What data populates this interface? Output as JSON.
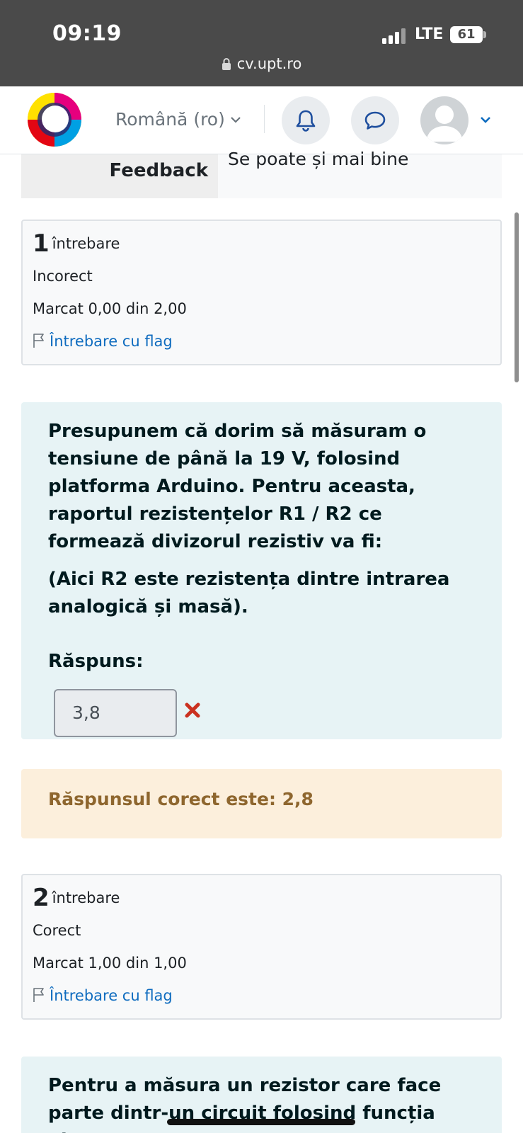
{
  "status_bar": {
    "time": "09:19",
    "network": "LTE",
    "battery": "61"
  },
  "browser": {
    "url": "cv.upt.ro"
  },
  "nav": {
    "language": "Română (ro)"
  },
  "feedback_row": {
    "label": "Feedback",
    "value": "Se poate și mai bine"
  },
  "questions": [
    {
      "number": "1",
      "word": "întrebare",
      "state": "Incorect",
      "grade": "Marcat 0,00 din 2,00",
      "flag_label": "Întrebare cu flag",
      "text_p1": "Presupunem că dorim să măsuram o tensiune de până la 19 V, folosind platforma Arduino. Pentru aceasta, raportul rezistențelor R1 / R2 ce formează divizorul rezistiv va fi:",
      "text_p2": "(Aici R2 este rezistența dintre intrarea analogică și masă).",
      "answer_label": "Răspuns:",
      "answer_value": "3,8",
      "right_answer": "Răspunsul corect este: 2,8"
    },
    {
      "number": "2",
      "word": "întrebare",
      "state": "Corect",
      "grade": "Marcat 1,00 din 1,00",
      "flag_label": "Întrebare cu flag",
      "text_p1": "Pentru a măsura un rezistor care face parte dintr-un circuit folosind funcția ohmmetru a"
    }
  ],
  "colors": {
    "link": "#0f6cbf",
    "formulation_bg": "#e7f3f5",
    "outcome_bg": "#fcefdc",
    "outcome_text": "#8e662e",
    "incorrect": "#ca3120"
  },
  "icons": [
    "lock-icon",
    "chevron-down-icon",
    "bell-icon",
    "chat-icon",
    "avatar-icon",
    "flag-icon",
    "incorrect-x-icon"
  ]
}
